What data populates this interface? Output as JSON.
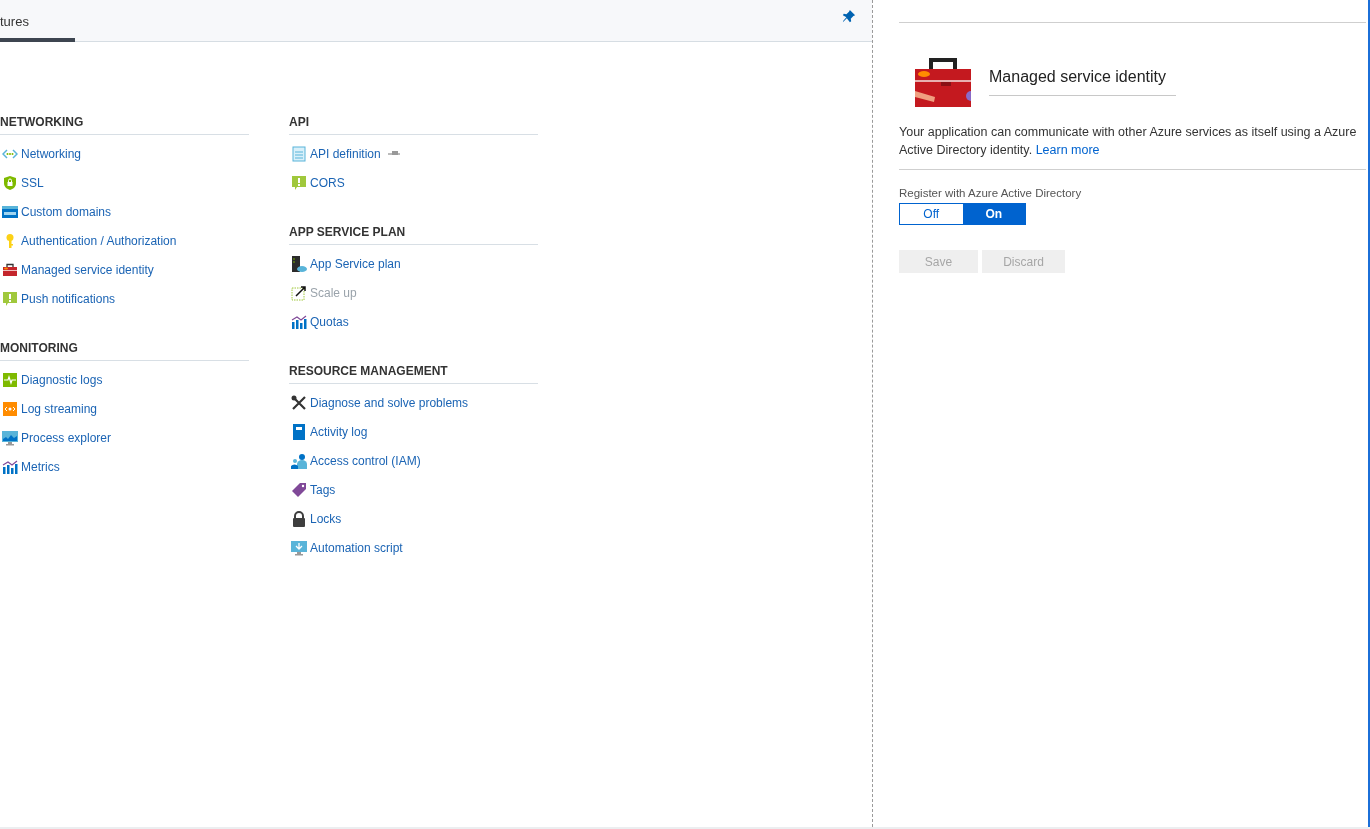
{
  "tab_bar": {
    "tabs": [
      {
        "label": "tures",
        "selected": true
      }
    ]
  },
  "columns": [
    {
      "sections": [
        {
          "heading": "NETWORKING",
          "items": [
            {
              "label": "Networking",
              "kind": "network",
              "disabled": false
            },
            {
              "label": "SSL",
              "kind": "shield",
              "disabled": false
            },
            {
              "label": "Custom domains",
              "kind": "www",
              "disabled": false
            },
            {
              "label": "Authentication / Authorization",
              "kind": "key",
              "disabled": false
            },
            {
              "label": "Managed service identity",
              "kind": "toolbox",
              "disabled": false
            },
            {
              "label": "Push notifications",
              "kind": "alert",
              "disabled": false
            }
          ]
        },
        {
          "heading": "MONITORING",
          "items": [
            {
              "label": "Diagnostic logs",
              "kind": "pulse",
              "disabled": false
            },
            {
              "label": "Log streaming",
              "kind": "stream",
              "disabled": false
            },
            {
              "label": "Process explorer",
              "kind": "monitor",
              "disabled": false
            },
            {
              "label": "Metrics",
              "kind": "chart",
              "disabled": false
            }
          ]
        }
      ]
    },
    {
      "sections": [
        {
          "heading": "API",
          "items": [
            {
              "label": "API definition",
              "kind": "document",
              "disabled": false,
              "preview": true
            },
            {
              "label": "CORS",
              "kind": "alert",
              "disabled": false
            }
          ]
        },
        {
          "heading": "APP SERVICE PLAN",
          "items": [
            {
              "label": "App Service plan",
              "kind": "server",
              "disabled": false
            },
            {
              "label": "Scale up",
              "kind": "scale",
              "disabled": true
            },
            {
              "label": "Quotas",
              "kind": "chart",
              "disabled": false
            }
          ]
        },
        {
          "heading": "RESOURCE MANAGEMENT",
          "items": [
            {
              "label": "Diagnose and solve problems",
              "kind": "tools",
              "disabled": false
            },
            {
              "label": "Activity log",
              "kind": "book",
              "disabled": false
            },
            {
              "label": "Access control (IAM)",
              "kind": "people",
              "disabled": false
            },
            {
              "label": "Tags",
              "kind": "tag",
              "disabled": false
            },
            {
              "label": "Locks",
              "kind": "lock",
              "disabled": false
            },
            {
              "label": "Automation script",
              "kind": "download",
              "disabled": false
            }
          ]
        }
      ]
    }
  ],
  "detail": {
    "title": "Managed service identity",
    "description": "Your application can communicate with other Azure services as itself using a",
    "description_2": "Azure Active Directory identity.",
    "link": "Learn more",
    "toggle_label": "Register with Azure Active Directory",
    "toggle": [
      {
        "label": "Off",
        "selected": false
      },
      {
        "label": "On",
        "selected": true
      }
    ],
    "buttons": [
      {
        "label": "Save",
        "disabled": true
      },
      {
        "label": "Discard",
        "disabled": true
      }
    ]
  }
}
